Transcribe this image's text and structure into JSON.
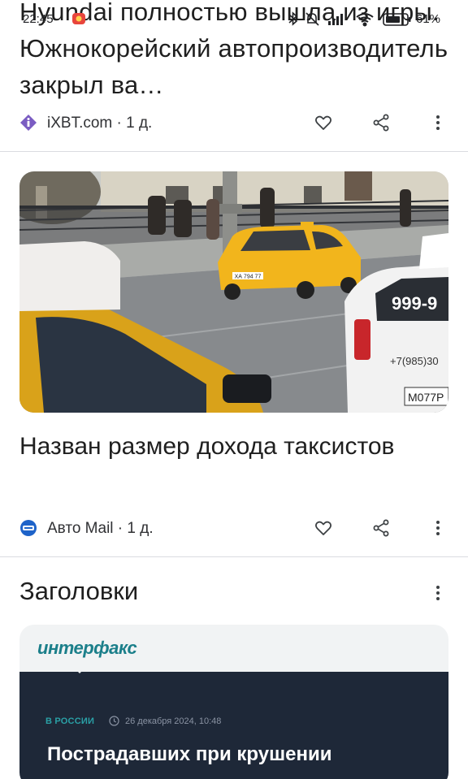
{
  "status_bar": {
    "time": "22:45",
    "battery_percent": "61%",
    "icons": [
      "bluetooth-icon",
      "bell-off-icon",
      "signal-icon",
      "wifi-icon",
      "battery-icon"
    ]
  },
  "article_1": {
    "headline": "Hyundai полностью вышла из игры. Южнокорейский автопроизводитель закрыл ва…",
    "source": "iXBT.com · 1 д."
  },
  "article_2": {
    "headline": "Назван размер дохода таксистов",
    "source": "Авто Mail · 1 д.",
    "photo_text": {
      "plate_front": "ХА 794 77",
      "phone_big": "999-9",
      "phone_small": "+7(985)30",
      "plate_right": "М077Р"
    }
  },
  "headlines_section": {
    "title": "Заголовки",
    "card": {
      "logo": "интерфакс",
      "tag": "В РОССИИ",
      "date": "26 декабря 2024, 10:48",
      "headline": "Пострадавших при крушении"
    }
  },
  "colors": {
    "divider": "#dadce0",
    "interfax_teal": "#1b7f8a",
    "card_dark": "#1e2838",
    "taxi_yellow": "#f2b51c"
  }
}
